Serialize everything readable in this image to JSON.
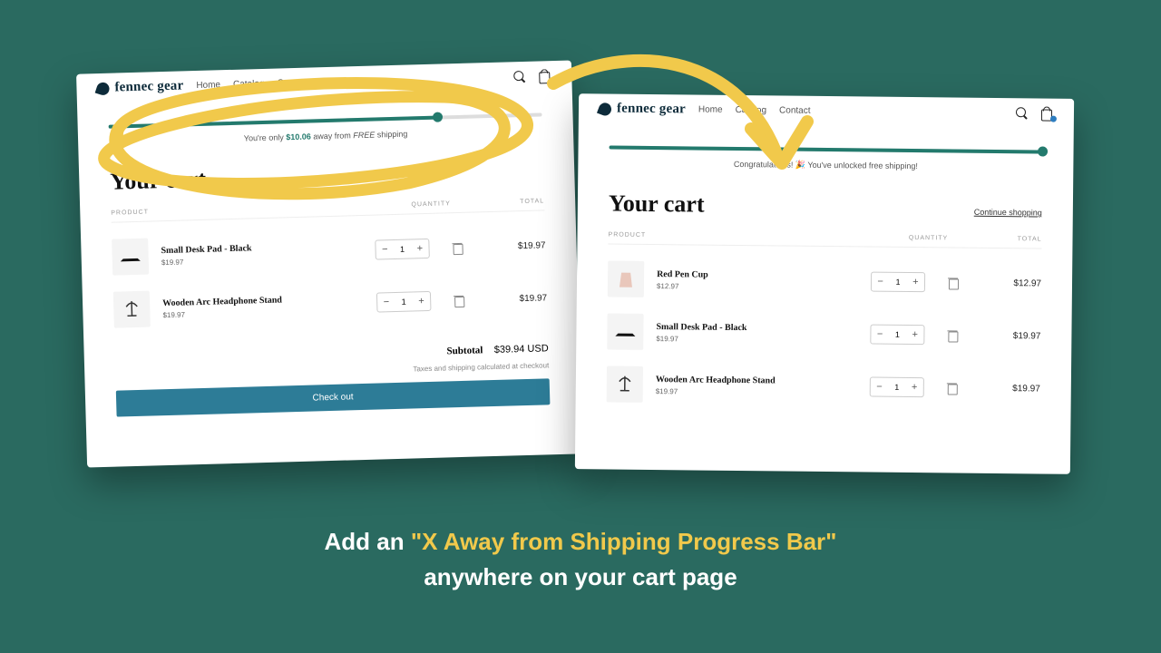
{
  "brand": "fennec gear",
  "nav": {
    "home": "Home",
    "catalog": "Catalog",
    "contact": "Contact"
  },
  "cardA": {
    "progress_pct": 76,
    "msg_pre": "You're only ",
    "msg_amt": "$10.06",
    "msg_mid": " away from ",
    "msg_em": "FREE",
    "msg_post": " shipping",
    "cart_title": "Your cart",
    "hdr_product": "Product",
    "hdr_qty": "Quantity",
    "hdr_total": "Total",
    "items": [
      {
        "name": "Small Desk Pad - Black",
        "price": "$19.97",
        "qty": "1",
        "line": "$19.97"
      },
      {
        "name": "Wooden Arc Headphone Stand",
        "price": "$19.97",
        "qty": "1",
        "line": "$19.97"
      }
    ],
    "subtotal_label": "Subtotal",
    "subtotal_value": "$39.94 USD",
    "tax_note": "Taxes and shipping calculated at checkout",
    "checkout_label": "Check out"
  },
  "cardB": {
    "progress_pct": 100,
    "msg_full": "Congratulations! 🎉 You've unlocked free shipping!",
    "cart_title": "Your cart",
    "continue_label": "Continue shopping",
    "hdr_product": "Product",
    "hdr_qty": "Quantity",
    "hdr_total": "Total",
    "items": [
      {
        "name": "Red Pen Cup",
        "price": "$12.97",
        "qty": "1",
        "line": "$12.97"
      },
      {
        "name": "Small Desk Pad - Black",
        "price": "$19.97",
        "qty": "1",
        "line": "$19.97"
      },
      {
        "name": "Wooden Arc Headphone Stand",
        "price": "$19.97",
        "qty": "1",
        "line": "$19.97"
      }
    ]
  },
  "tagline": {
    "pre": "Add an ",
    "quote": "\"X Away from Shipping Progress Bar\"",
    "post": "anywhere on your cart page"
  }
}
